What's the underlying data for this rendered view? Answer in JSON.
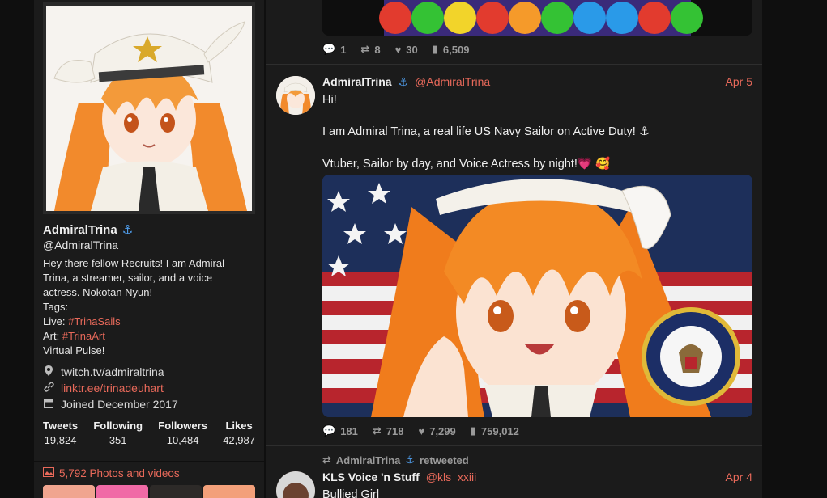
{
  "profile": {
    "name": "AdmiralTrina",
    "anchor_glyph": "⚓",
    "handle": "@AdmiralTrina",
    "bio": {
      "line1": "Hey there fellow Recruits! I am Admiral",
      "line2": "Trina, a streamer, sailor, and a voice",
      "line3": "actress. Nokotan Nyun!",
      "line4": "Tags:",
      "live_label": "Live:",
      "live_tag": "#TrinaSails",
      "art_label": "Art:",
      "art_tag": "#TrinaArt",
      "line7": "Virtual Pulse!"
    },
    "location": "twitch.tv/admiraltrina",
    "link": "linktr.ee/trinadeuhart",
    "joined": "Joined December 2017",
    "stats": [
      {
        "label": "Tweets",
        "value": "19,824"
      },
      {
        "label": "Following",
        "value": "351"
      },
      {
        "label": "Followers",
        "value": "10,484"
      },
      {
        "label": "Likes",
        "value": "42,987"
      }
    ]
  },
  "media": {
    "title": "5,792 Photos and videos"
  },
  "top_tweet": {
    "replies": "1",
    "retweets": "8",
    "likes": "30",
    "views": "6,509"
  },
  "tweet": {
    "name": "AdmiralTrina",
    "handle": "@AdmiralTrina",
    "date": "Apr 5",
    "line1": "Hi!",
    "line2": "I am Admiral Trina, a real life US Navy Sailor on Active Duty! ⚓",
    "line3": "Vtuber, Sailor by day, and Voice Actress by night!💗 🥰",
    "replies": "181",
    "retweets": "718",
    "likes": "7,299",
    "views": "759,012"
  },
  "retweet_banner": {
    "name": "AdmiralTrina",
    "suffix": "retweeted"
  },
  "next_tweet": {
    "name": "KLS Voice 'n Stuff",
    "handle": "@kls_xxiii",
    "date": "Apr 4",
    "text": "Bullied Girl"
  },
  "colors": {
    "accent": "#e8695a",
    "anchor": "#4e9be8",
    "card": "#1b1b1b",
    "background": "#0f0f0f"
  }
}
